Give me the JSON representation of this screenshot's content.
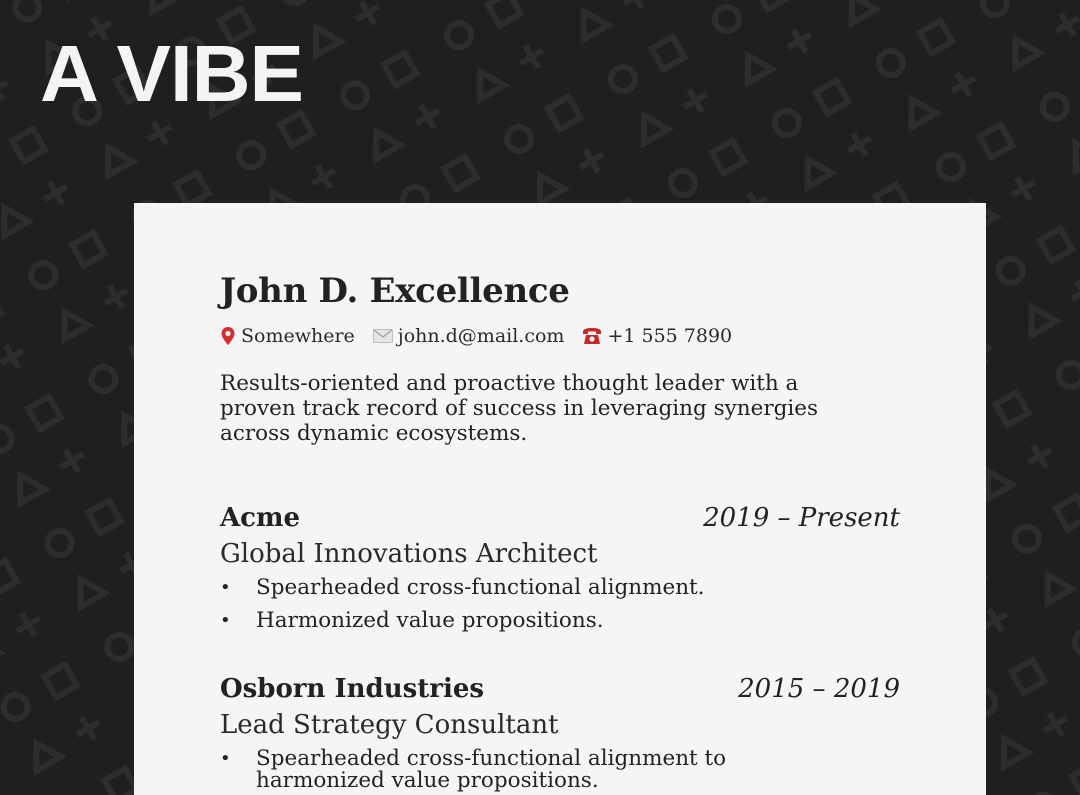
{
  "hero": {
    "title": "A VIBE"
  },
  "resume": {
    "name": "John D. Excellence",
    "contact": {
      "location": "Somewhere",
      "location_icon": "map-pin-icon",
      "email": "john.d@mail.com",
      "email_icon": "envelope-icon",
      "phone": "+1 555 7890",
      "phone_icon": "telephone-icon"
    },
    "summary": "Results-oriented and proactive thought leader with a proven track record of success in leveraging synergies across dynamic ecosystems.",
    "experience": [
      {
        "company": "Acme",
        "dates": "2019 – Present",
        "role": "Global Innovations Architect",
        "bullets": [
          "Spearheaded cross-functional alignment.",
          "Harmonized value propositions."
        ]
      },
      {
        "company": "Osborn Industries",
        "dates": "2015 – 2019",
        "role": "Lead Strategy Consultant",
        "bullets": [
          "Spearheaded cross-functional alignment to harmonized value propositions."
        ]
      }
    ]
  },
  "colors": {
    "background": "#1f1f1f",
    "pattern": "#2c2c2c",
    "card": "#f5f5f5",
    "text": "#222222",
    "pin_red": "#d32f2f",
    "phone_red": "#c62828"
  }
}
